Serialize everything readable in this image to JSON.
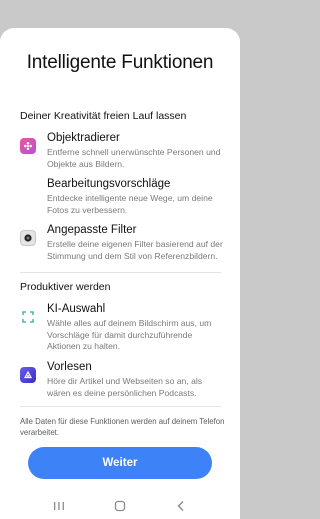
{
  "title": "Intelligente Funktionen",
  "sections": [
    {
      "heading": "Deiner Kreativität freien Lauf lassen",
      "features": [
        {
          "name": "Objektradierer",
          "desc": "Entferne schnell unerwünschte Personen und Objekte aus Bildern.",
          "icon": "eraser-icon"
        },
        {
          "name": "Bearbeitungsvorschläge",
          "desc": "Entdecke intelligente neue Wege, um deine Fotos zu verbessern.",
          "icon": ""
        },
        {
          "name": "Angepasste Filter",
          "desc": "Erstelle deine eigenen Filter basierend auf der Stimmung und dem Stil von Referenzbildern.",
          "icon": "filter-icon"
        }
      ]
    },
    {
      "heading": "Produktiver werden",
      "features": [
        {
          "name": "KI-Auswahl",
          "desc": "Wähle alles auf deinem Bildschirm aus, um Vorschläge für damit durchzuführende Aktionen zu halten.",
          "icon": "selection-icon"
        },
        {
          "name": "Vorlesen",
          "desc": "Höre dir Artikel und Webseiten so an, als wären es deine persönlichen Podcasts.",
          "icon": "read-aloud-icon"
        }
      ]
    }
  ],
  "footnote": "Alle Daten für diese Funktionen werden auf deinem Telefon verarbeitet.",
  "button_label": "Weiter",
  "colors": {
    "accent": "#3e82f7",
    "eraser": "#e8458f",
    "read_aloud": "#5a3fd6",
    "selection": "#2ea8a0"
  },
  "navbar": {
    "recents": "recents-icon",
    "home": "home-icon",
    "back": "back-icon"
  }
}
